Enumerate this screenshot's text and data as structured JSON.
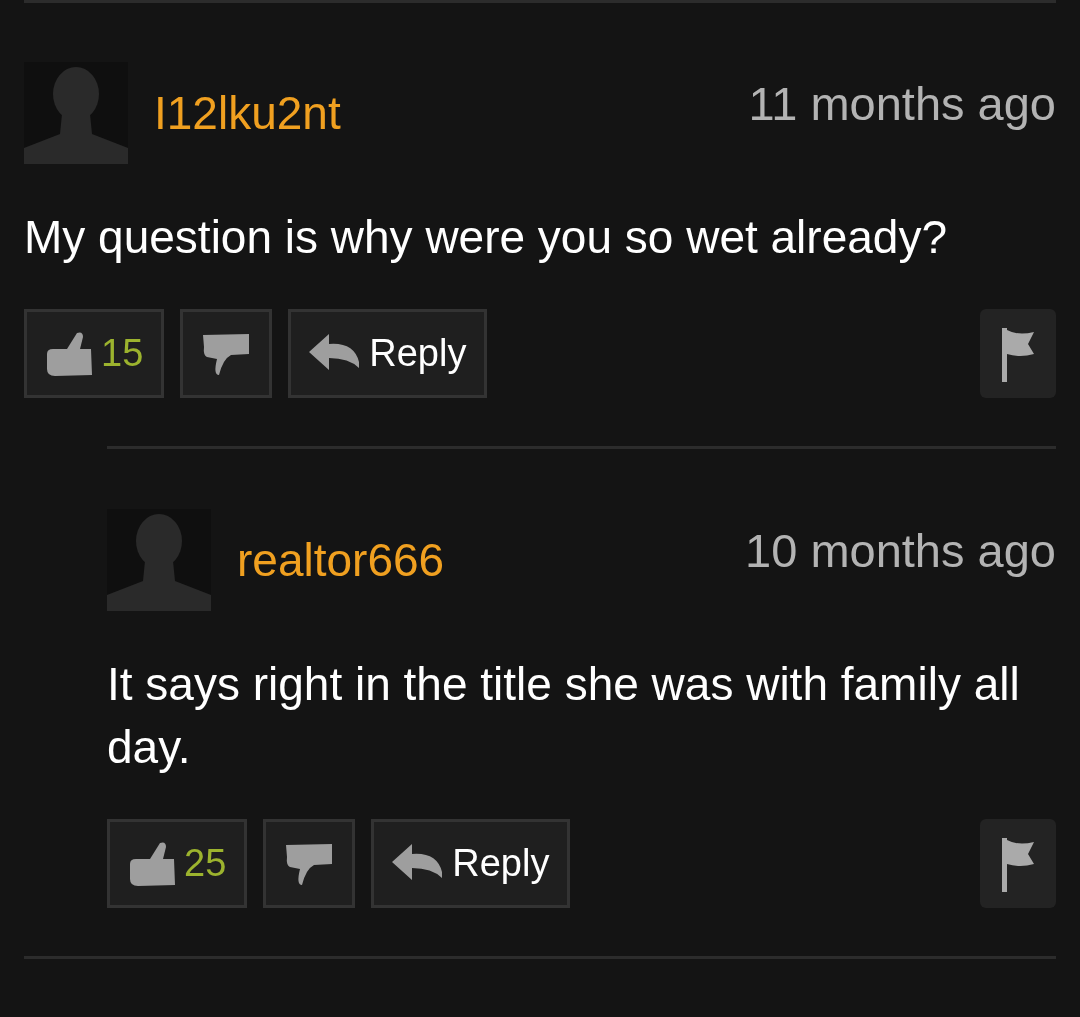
{
  "comments": [
    {
      "username": "I12lku2nt",
      "time": "11 months ago",
      "text": "My question is why were you so wet already?",
      "likes": "15",
      "reply_label": "Reply",
      "children": [
        {
          "username": "realtor666",
          "time": "10 months ago",
          "text": "It says right in the title she was with family all day.",
          "likes": "25",
          "reply_label": "Reply"
        }
      ]
    }
  ]
}
